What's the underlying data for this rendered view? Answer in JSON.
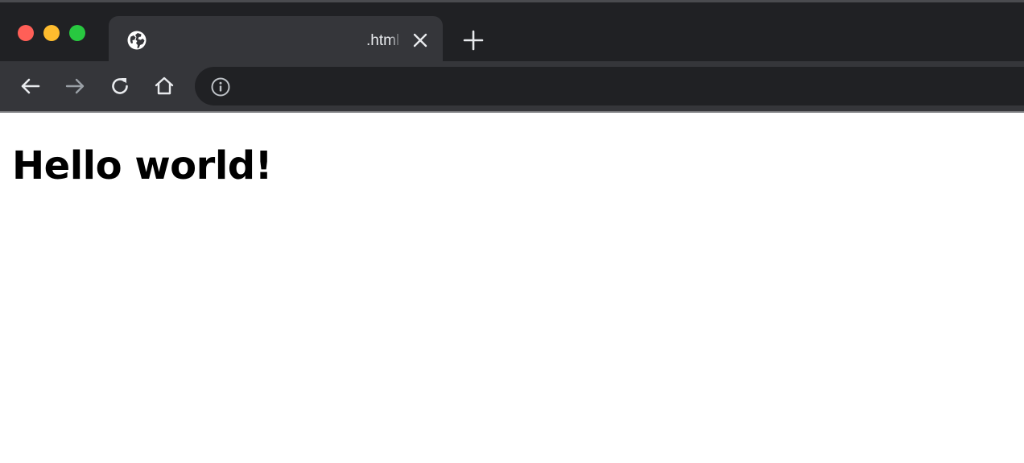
{
  "tab": {
    "title": ".html",
    "favicon": "globe-icon",
    "close_icon": "close-icon"
  },
  "window_controls": {
    "close_color": "#ff5f57",
    "minimize_color": "#febc2e",
    "zoom_color": "#28c840"
  },
  "toolbar": {
    "back_icon": "back-arrow-icon",
    "forward_icon": "forward-arrow-icon",
    "reload_icon": "reload-icon",
    "home_icon": "home-icon",
    "new_tab_icon": "plus-icon"
  },
  "omnibox": {
    "site_info_icon": "info-icon",
    "url": ""
  },
  "page": {
    "heading": "Hello world!"
  },
  "theme": {
    "tabstrip_bg": "#202124",
    "active_tab_bg": "#35363a",
    "omnibox_bg": "#202124",
    "icon_color": "#e8eaed",
    "disabled_icon_color": "#9aa0a6"
  }
}
